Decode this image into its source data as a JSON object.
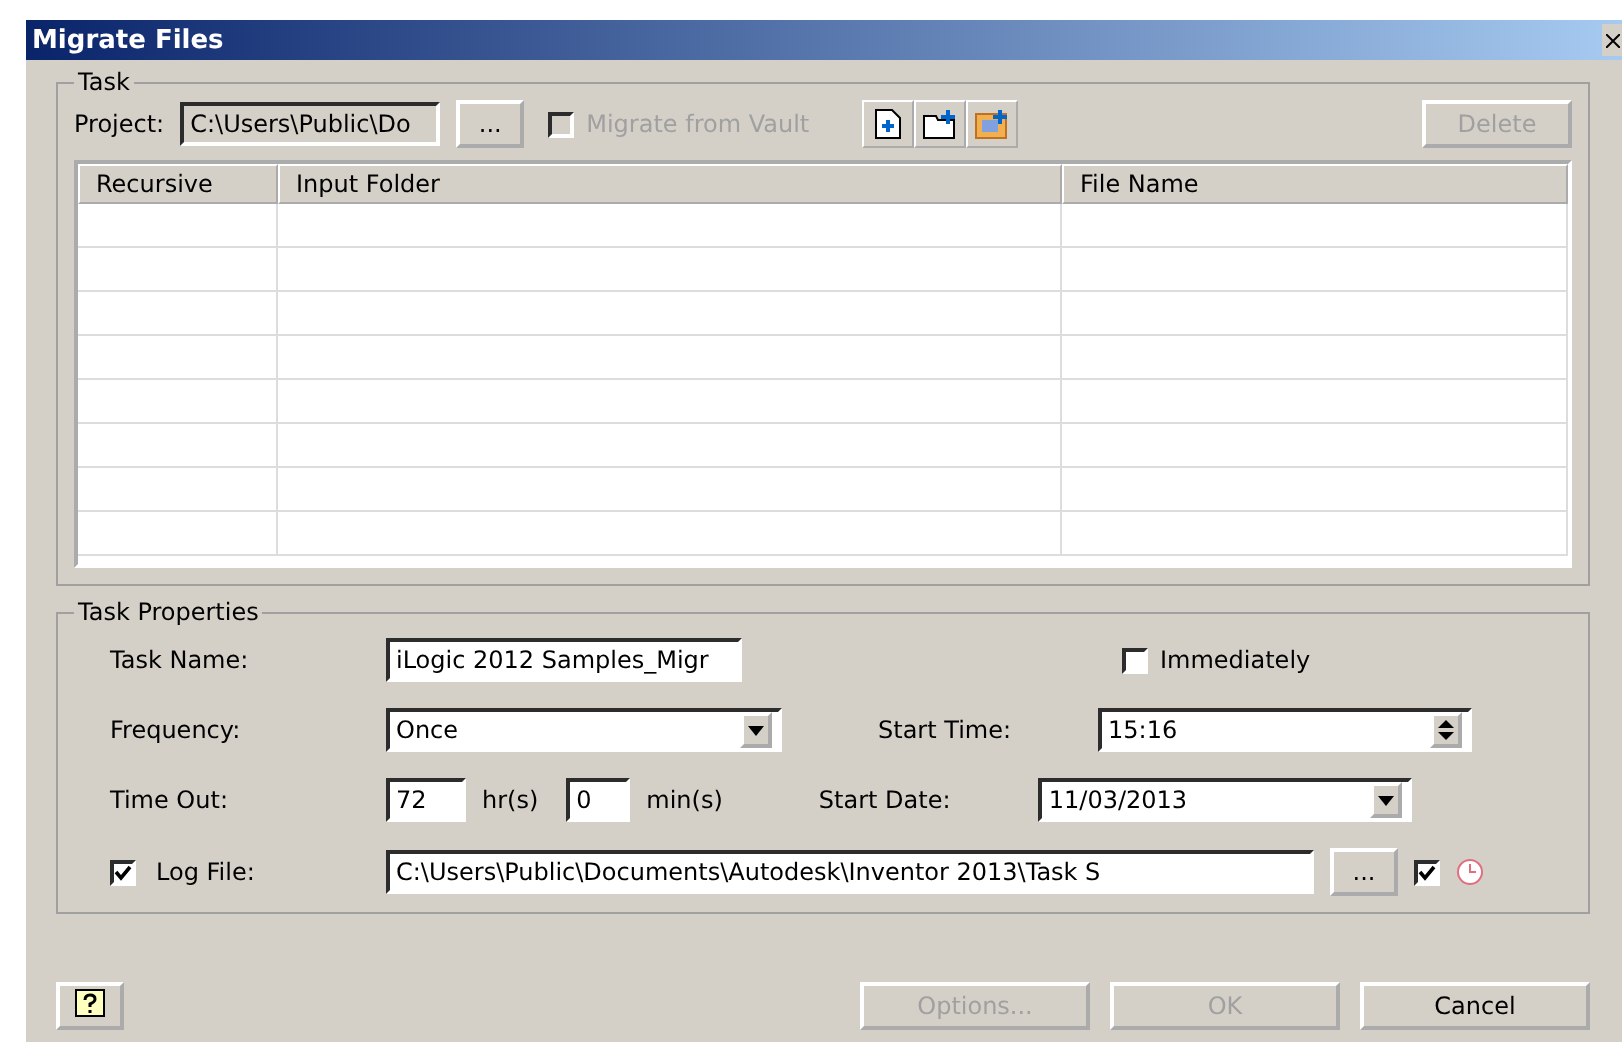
{
  "window": {
    "title": "Migrate Files"
  },
  "task": {
    "title": "Task",
    "project_label": "Project:",
    "project_value": "C:\\Users\\Public\\Do",
    "browse": "...",
    "migrate_from_vault": {
      "label": "Migrate from Vault",
      "checked": false,
      "disabled": true
    },
    "delete": {
      "label": "Delete",
      "disabled": true
    }
  },
  "table": {
    "columns": [
      "Recursive",
      "Input Folder",
      "File Name"
    ]
  },
  "task_properties": {
    "title": "Task Properties",
    "task_name": {
      "label": "Task Name:",
      "value": "iLogic 2012 Samples_Migr"
    },
    "immediately": {
      "label": "Immediately",
      "checked": false
    },
    "frequency": {
      "label": "Frequency:",
      "value": "Once"
    },
    "start_time": {
      "label": "Start Time:",
      "value": "15:16"
    },
    "time_out": {
      "label": "Time Out:",
      "hours": "72",
      "hours_unit": "hr(s)",
      "minutes": "0",
      "minutes_unit": "min(s)"
    },
    "start_date": {
      "label": "Start Date:",
      "value": "11/03/2013"
    },
    "log_file": {
      "label": "Log File:",
      "checked": true,
      "value": "C:\\Users\\Public\\Documents\\Autodesk\\Inventor 2013\\Task S",
      "browse": "...",
      "option_checked": true
    }
  },
  "buttons": [
    {
      "label": "Options...",
      "disabled": true
    },
    {
      "label": "OK",
      "disabled": true
    },
    {
      "label": "Cancel",
      "disabled": false
    }
  ]
}
